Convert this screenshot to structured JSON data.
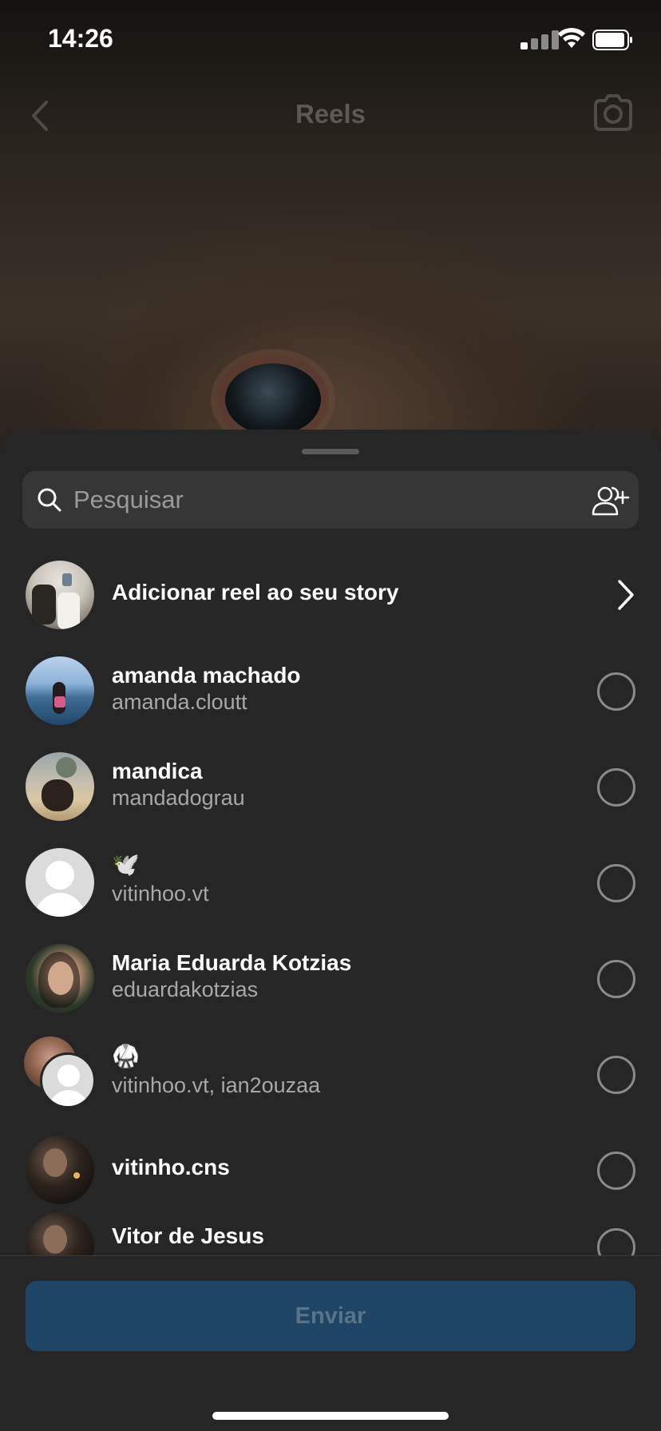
{
  "status_bar": {
    "time": "14:26"
  },
  "nav": {
    "title": "Reels"
  },
  "search": {
    "placeholder": "Pesquisar"
  },
  "story_row": {
    "label": "Adicionar reel ao seu story"
  },
  "contacts": [
    {
      "name": "amanda machado",
      "username": "amanda.cloutt",
      "avatar": "photo"
    },
    {
      "name": "mandica",
      "username": "mandadograu",
      "avatar": "photo"
    },
    {
      "name": "🕊️",
      "username": "vitinhoo.vt",
      "avatar": "default"
    },
    {
      "name": "Maria Eduarda Kotzias",
      "username": "eduardakotzias",
      "avatar": "photo"
    },
    {
      "name": "🥋",
      "username": "vitinhoo.vt, ian2ouzaa",
      "avatar": "group"
    },
    {
      "name": "vitinho.cns",
      "username": "",
      "avatar": "photo"
    },
    {
      "name": "Vitor de Jesus",
      "username": "",
      "avatar": "photo"
    }
  ],
  "footer": {
    "send_label": "Enviar"
  },
  "colors": {
    "sheet": "#262626",
    "search_bg": "#363636",
    "send_button": "#1d4566",
    "secondary_text": "#a8a8a8"
  },
  "icons": [
    "back-icon",
    "camera-icon",
    "search-icon",
    "add-people-icon",
    "chevron-right-icon",
    "radio-icon"
  ]
}
